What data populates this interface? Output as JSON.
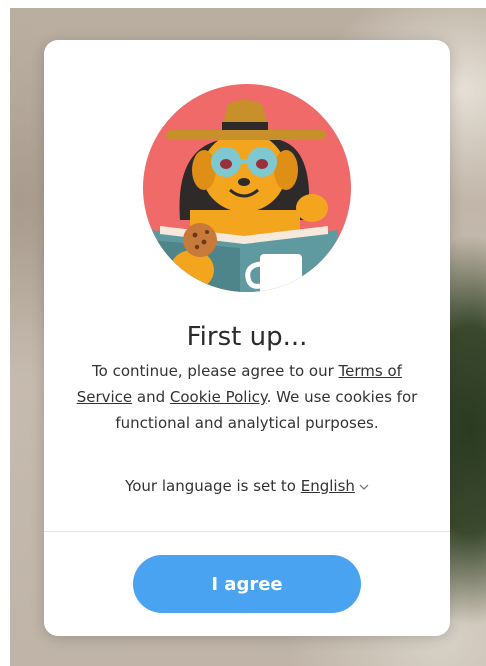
{
  "dialog": {
    "title": "First up...",
    "text_before_terms": "To continue, please agree to our ",
    "terms_link": "Terms of Service",
    "text_between": " and ",
    "cookie_link": "Cookie Policy",
    "text_after": ". We use cookies for functional and analytical purposes.",
    "language_prefix": "Your language is set to ",
    "language_value": "English",
    "agree_label": "I agree"
  },
  "icons": {
    "illustration": "dog-reading-book-illustration",
    "language_chevron": "chevron-down-icon"
  },
  "colors": {
    "button": "#4aa3f0",
    "illustration_sky": "#f06a6a",
    "illustration_dog": "#f3a51e",
    "illustration_book": "#5f9aa0"
  }
}
